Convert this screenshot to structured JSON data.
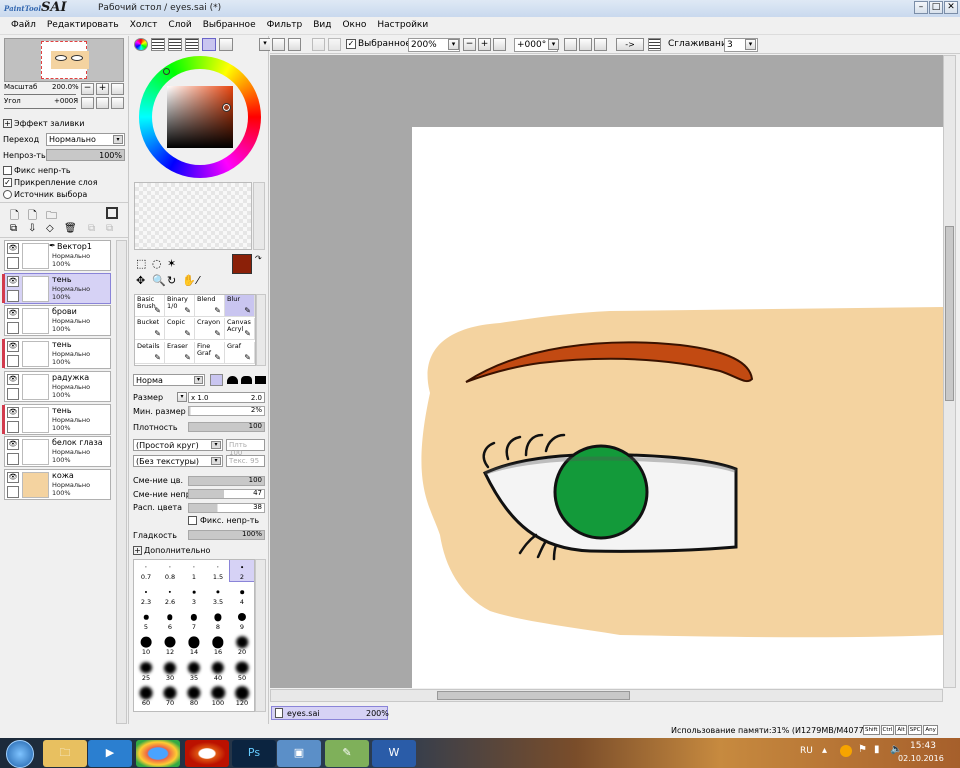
{
  "app": {
    "logo_main": "SAI",
    "logo_sub": "PaintTool",
    "window_title": "Рабочий стол / eyes.sai (*)"
  },
  "menu": [
    "Файл",
    "Редактировать",
    "Холст",
    "Слой",
    "Выбранное",
    "Фильтр",
    "Вид",
    "Окно",
    "Настройки"
  ],
  "navigator": {
    "zoom_label": "Масштаб",
    "zoom_value": "200.0%",
    "angle_label": "Угол",
    "angle_value": "+000Я"
  },
  "layer_props": {
    "effect_label": "Эффект заливки",
    "blend_label": "Переход",
    "blend_value": "Нормально",
    "opacity_label": "Непроз-ть",
    "opacity_value": "100%",
    "fix_opacity": "Фикс непр-ть",
    "fix_opacity_checked": false,
    "clip": "Прикрепление слоя",
    "clip_checked": true,
    "selection_source": "Источник выбора"
  },
  "layers": [
    {
      "name": "Вектор1",
      "mode": "Нормально",
      "opacity": "100%",
      "selected": false,
      "vector": true,
      "clip_mark": false
    },
    {
      "name": "тень",
      "mode": "Нормально",
      "opacity": "100%",
      "selected": true,
      "vector": false,
      "clip_mark": true
    },
    {
      "name": "брови",
      "mode": "Нормально",
      "opacity": "100%",
      "selected": false,
      "vector": false,
      "clip_mark": false
    },
    {
      "name": "тень",
      "mode": "Нормально",
      "opacity": "100%",
      "selected": false,
      "vector": false,
      "clip_mark": true
    },
    {
      "name": "радужка",
      "mode": "Нормально",
      "opacity": "100%",
      "selected": false,
      "vector": false,
      "clip_mark": false
    },
    {
      "name": "тень",
      "mode": "Нормально",
      "opacity": "100%",
      "selected": false,
      "vector": false,
      "clip_mark": true
    },
    {
      "name": "белок глаза",
      "mode": "Нормально",
      "opacity": "100%",
      "selected": false,
      "vector": false,
      "clip_mark": false
    },
    {
      "name": "кожа",
      "mode": "Нормально",
      "opacity": "100%",
      "selected": false,
      "vector": false,
      "clip_mark": false
    }
  ],
  "colors": {
    "primary": "#8b2008",
    "secondary": "#ffffff",
    "skin": "#f4d3a0",
    "brow": "#c24a12",
    "iris": "#139a3a",
    "canvas_bg": "#a8a8a8",
    "selected_bg": "#d6d2f5"
  },
  "tools": [
    {
      "name": "Basic Brush",
      "l1": "Basic",
      "l2": "Brush"
    },
    {
      "name": "Binary 1/0",
      "l1": "Binary",
      "l2": "1/0"
    },
    {
      "name": "Blend",
      "l1": "Blend",
      "l2": ""
    },
    {
      "name": "Blur",
      "l1": "Blur",
      "l2": "",
      "selected": true
    },
    {
      "name": "Bucket",
      "l1": "Bucket",
      "l2": ""
    },
    {
      "name": "Copic",
      "l1": "Copic",
      "l2": ""
    },
    {
      "name": "Crayon",
      "l1": "Crayon",
      "l2": ""
    },
    {
      "name": "Canvas Acryl",
      "l1": "Canvas",
      "l2": "Acryl"
    },
    {
      "name": "Details",
      "l1": "Details",
      "l2": ""
    },
    {
      "name": "Eraser",
      "l1": "Eraser",
      "l2": ""
    },
    {
      "name": "Fine Graf",
      "l1": "Fine",
      "l2": "Graf"
    },
    {
      "name": "Graf",
      "l1": "Graf",
      "l2": ""
    }
  ],
  "brush": {
    "mode": "Норма",
    "size_label": "Размер",
    "size_mult": "x 1.0",
    "size_value": "2.0",
    "min_size_label": "Мин. размер",
    "min_size_value": "2%",
    "min_size_pct": 2,
    "density_label": "Плотность",
    "density_value": "100",
    "density_pct": 100,
    "shape": "(Простой круг)",
    "shape_strength": "Плть 100",
    "texture": "(Без текстуры)",
    "texture_strength": "Текс. 95",
    "blend_label": "Сме-ние цв.",
    "blend_value": "100",
    "blend_pct": 100,
    "dilution_label": "Сме-ние непр.",
    "dilution_value": "47",
    "dilution_pct": 47,
    "persistence_label": "Расп. цвета",
    "persistence_value": "38",
    "persistence_pct": 38,
    "fix_opacity": "Фикс. непр-ть",
    "smooth_label": "Гладкость",
    "smooth_value": "100%",
    "smooth_pct": 100,
    "advanced": "Дополнительно"
  },
  "brush_sizes": [
    "0.7",
    "0.8",
    "1",
    "1.5",
    "2",
    "2.3",
    "2.6",
    "3",
    "3.5",
    "4",
    "5",
    "6",
    "7",
    "8",
    "9",
    "10",
    "12",
    "14",
    "16",
    "20",
    "25",
    "30",
    "35",
    "40",
    "50",
    "60",
    "70",
    "80",
    "100",
    "120"
  ],
  "brush_size_selected": "2",
  "toolbar": {
    "selection_label": "Выбранное",
    "zoom": "200%",
    "angle": "+000°",
    "arrow": "->",
    "smooth_label": "Сглаживание",
    "smooth_value": "3"
  },
  "doc_tab": {
    "name": "eyes.sai",
    "zoom": "200%"
  },
  "status": {
    "memory": "Использование памяти:31% (И1279MB/M4077MB)",
    "keys": [
      "Shift",
      "Ctrl",
      "Alt",
      "SPC",
      "Any"
    ]
  },
  "taskbar": {
    "lang": "RU",
    "time": "15:43",
    "date": "02.10.2016"
  }
}
